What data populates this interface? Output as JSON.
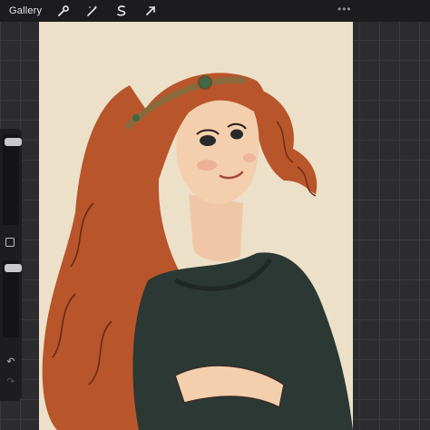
{
  "topbar": {
    "gallery_label": "Gallery",
    "tools": [
      {
        "name": "wrench-icon"
      },
      {
        "name": "adjustments-icon"
      },
      {
        "name": "selection-icon"
      },
      {
        "name": "transform-icon"
      }
    ],
    "more_label": "•••"
  },
  "sidebar": {
    "undo_glyph": "↶",
    "redo_glyph": "↷"
  },
  "canvas": {
    "subject": "illustration",
    "paper_color": "#ece0c8"
  },
  "colors": {
    "toolbar": "#1c1c1e",
    "workspace": "#2c2c2f",
    "hair": "#b8552b",
    "sweater": "#2c3833"
  }
}
